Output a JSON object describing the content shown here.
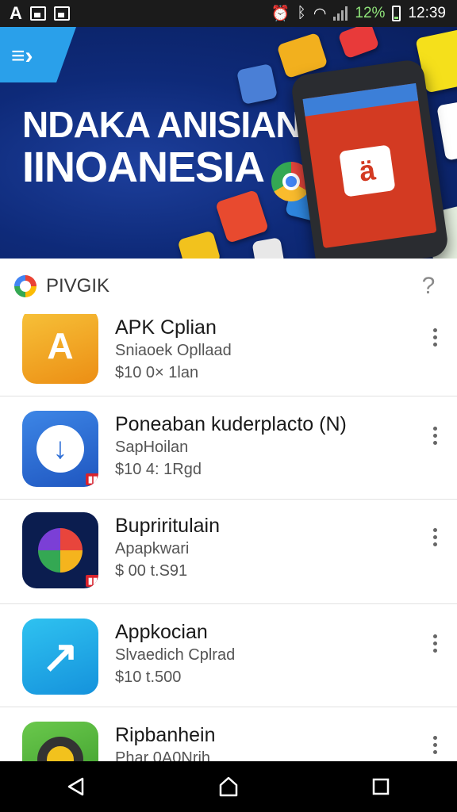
{
  "status_bar": {
    "left_icons": [
      "A",
      "image-icon",
      "photo-icon"
    ],
    "battery_percent": "12%",
    "time": "12:39"
  },
  "banner": {
    "title_line1": "NDAKA ANISIAN",
    "title_line2": "IINOANESIA"
  },
  "search": {
    "label": "PIVGIK",
    "help": "?"
  },
  "apps": [
    {
      "title": "APK Cplian",
      "subtitle": "Sniaoek Opllaad",
      "price": "$10 0× 1lan",
      "icon_color": "#f2a81d"
    },
    {
      "title": "Poneaban kuderplacto (N)",
      "subtitle": "SapHoilan",
      "price": "$10 4: 1Rgd",
      "icon_color": "#2f6fd6"
    },
    {
      "title": "Bupriritulain",
      "subtitle": "Apapkwari",
      "price": "$ 00 t.S91",
      "icon_color": "#0b1d4f"
    },
    {
      "title": "Appkocian",
      "subtitle": "Slvaedich Cplrad",
      "price": "$10 t.500",
      "icon_color": "#1ea9e8"
    },
    {
      "title": "Ripbanhein",
      "subtitle": "Phar 0A0Nrih",
      "price": "",
      "icon_color": "#5cb944"
    }
  ],
  "nav": {
    "back": "back-icon",
    "home": "home-icon",
    "recents": "recents-icon"
  }
}
